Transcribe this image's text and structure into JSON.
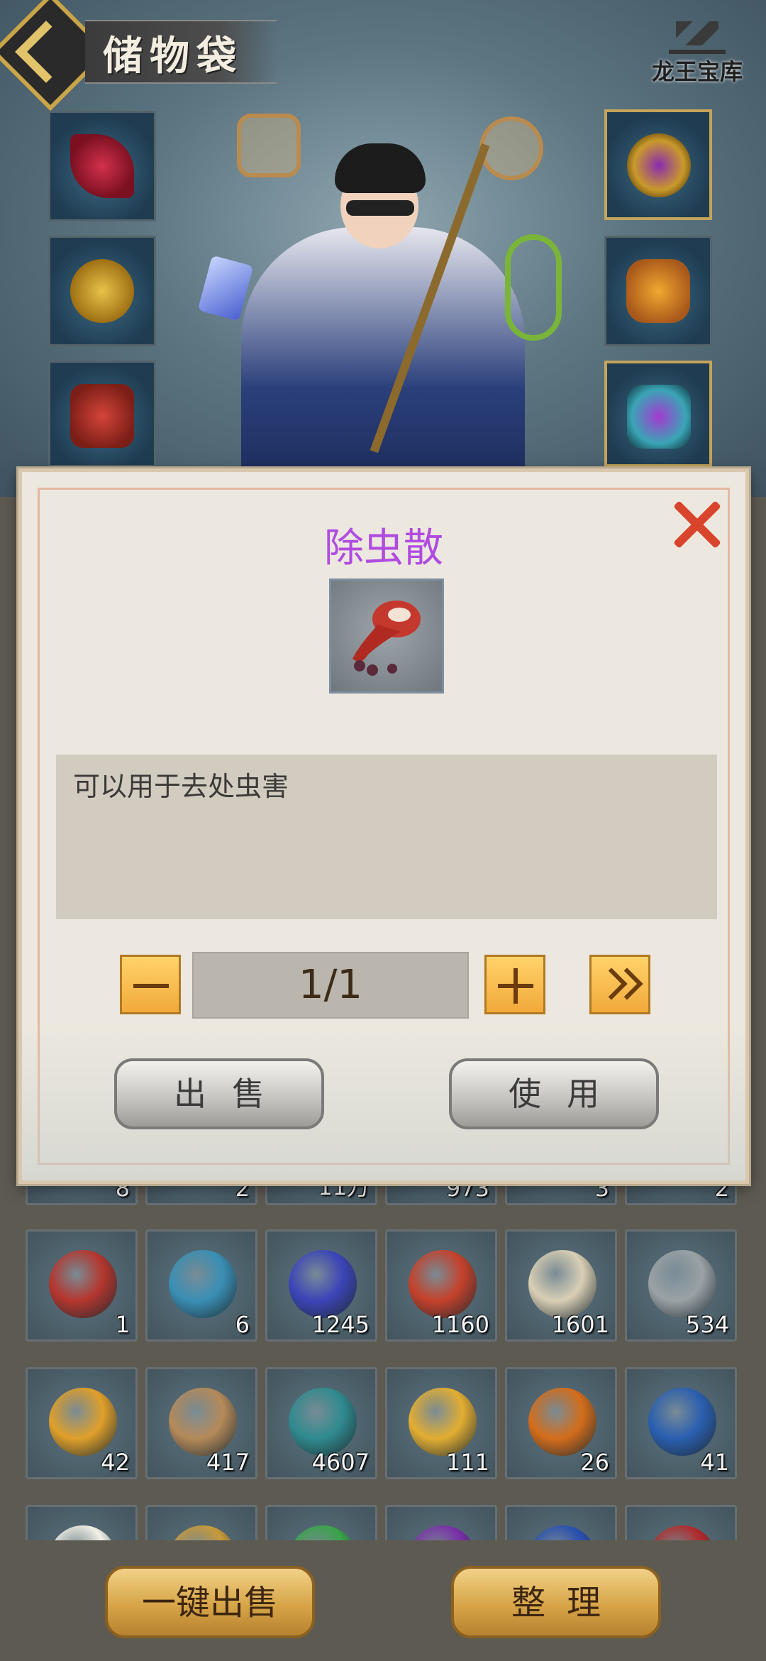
{
  "header": {
    "title": "储物袋",
    "brand": "龙王宝库"
  },
  "modal": {
    "item_name": "除虫散",
    "description": "可以用于去处虫害",
    "quantity": "1/1",
    "sell_label": "出售",
    "use_label": "使用"
  },
  "partial_row_counts": [
    "8",
    "2",
    "11万",
    "973",
    "3",
    "2"
  ],
  "inventory_rows": [
    [
      {
        "name": "除虫散",
        "count": "1",
        "icon": "red-gourd-icon",
        "color": "#b5362e"
      },
      {
        "name": "orb",
        "count": "6",
        "icon": "blue-orb-icon",
        "color": "#3a8fb5"
      },
      {
        "name": "gem",
        "count": "1245",
        "icon": "blue-gem-icon",
        "color": "#3b45b8"
      },
      {
        "name": "fruit",
        "count": "1160",
        "icon": "red-fruit-icon",
        "color": "#c5412b"
      },
      {
        "name": "skull",
        "count": "1601",
        "icon": "beast-skull-icon",
        "color": "#d9cfb5"
      },
      {
        "name": "claw",
        "count": "534",
        "icon": "claw-icon",
        "color": "#9aa2a6"
      }
    ],
    [
      {
        "name": "golden orb",
        "count": "42",
        "icon": "golden-orb-icon",
        "color": "#e0a02a"
      },
      {
        "name": "wood",
        "count": "417",
        "icon": "wood-cross-icon",
        "color": "#b58a5a"
      },
      {
        "name": "crystal",
        "count": "4607",
        "icon": "teal-crystal-icon",
        "color": "#2f8b8f"
      },
      {
        "name": "gold bar",
        "count": "111",
        "icon": "gold-bar-icon",
        "color": "#e3ae32"
      },
      {
        "name": "amber",
        "count": "26",
        "icon": "amber-orb-icon",
        "color": "#d46d1b"
      },
      {
        "name": "sea orb",
        "count": "41",
        "icon": "sea-orb-icon",
        "color": "#2a5fb0"
      }
    ],
    [
      {
        "name": "flower",
        "count": "",
        "icon": "flower-icon",
        "color": "#f2f0e6"
      },
      {
        "name": "item",
        "count": "",
        "icon": "gold-item-icon",
        "color": "#c99a3a"
      },
      {
        "name": "item",
        "count": "",
        "icon": "green-item-icon",
        "color": "#3aa44a"
      },
      {
        "name": "item",
        "count": "",
        "icon": "purple-orb-icon",
        "color": "#7a2fa8"
      },
      {
        "name": "item",
        "count": "",
        "icon": "blue-orb-icon",
        "color": "#2a4fb0"
      },
      {
        "name": "item",
        "count": "",
        "icon": "red-orb-icon",
        "color": "#b02a2a"
      }
    ]
  ],
  "bottom": {
    "sell_all_label": "一键出售",
    "sort_label": "整理"
  },
  "colors": {
    "item_name": "#b14be0",
    "close": "#d9442c",
    "gold": "#d7a548"
  }
}
